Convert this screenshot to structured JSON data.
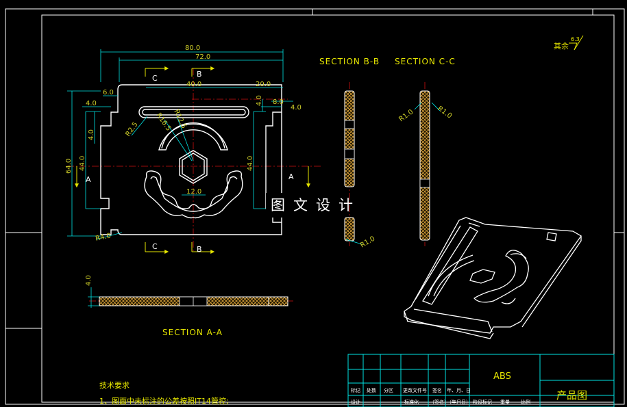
{
  "front_view": {
    "dims": {
      "overall_width": "80.0",
      "inner_width": "72.0",
      "slot_width": "40.0",
      "right_offset": "20.0",
      "top_tab": "6.0",
      "left_step_1": "4.0",
      "left_step_2": "4.0",
      "right_step_1": "4.0",
      "right_tab": "8.0",
      "right_step_2": "4.0",
      "overall_height": "64.0",
      "inner_height": "44.0",
      "right_height": "44.0",
      "hex_width": "12.0",
      "corner_radius": "R4.0",
      "slot_radius": "R2.5",
      "arc_radius_1": "R16.5",
      "arc_radius_2": "R12.5"
    },
    "section_marks": {
      "a_left": "A",
      "a_right": "A",
      "b_top": "B",
      "b_bottom": "B",
      "c_top": "C",
      "c_bottom": "C"
    }
  },
  "section_bb": {
    "title": "SECTION  B-B",
    "radius": "R1.0"
  },
  "section_cc": {
    "title": "SECTION  C-C",
    "radius_left": "R1.0",
    "radius_right": "R1.0"
  },
  "section_aa": {
    "title": "SECTION  A-A",
    "thickness": "4.0"
  },
  "watermark": "图文设计",
  "roughness": {
    "label": "其余",
    "value": "6.3"
  },
  "tech_notes": {
    "heading": "技术要求",
    "line1": "1、图面中未标注的公差按照IT14管控;"
  },
  "title_block": {
    "material": "ABS",
    "drawing_name": "产品图",
    "row_a": [
      "标记",
      "处数",
      "分区",
      "更改文件号",
      "签名",
      "年、月、日"
    ],
    "row_b": [
      "设计",
      "",
      "",
      "标准化",
      "（签名）",
      "（年月日）"
    ],
    "stage_labels": [
      "阶段标记",
      "重量",
      "比例"
    ]
  },
  "colors": {
    "border": "#ffffff",
    "outline": "#ffffff",
    "dimension": "#00e5e5",
    "dim_text": "#cfcf2a",
    "center_line": "#d01010",
    "hatch": "#d9a23a",
    "arrow": "#e6e600"
  }
}
